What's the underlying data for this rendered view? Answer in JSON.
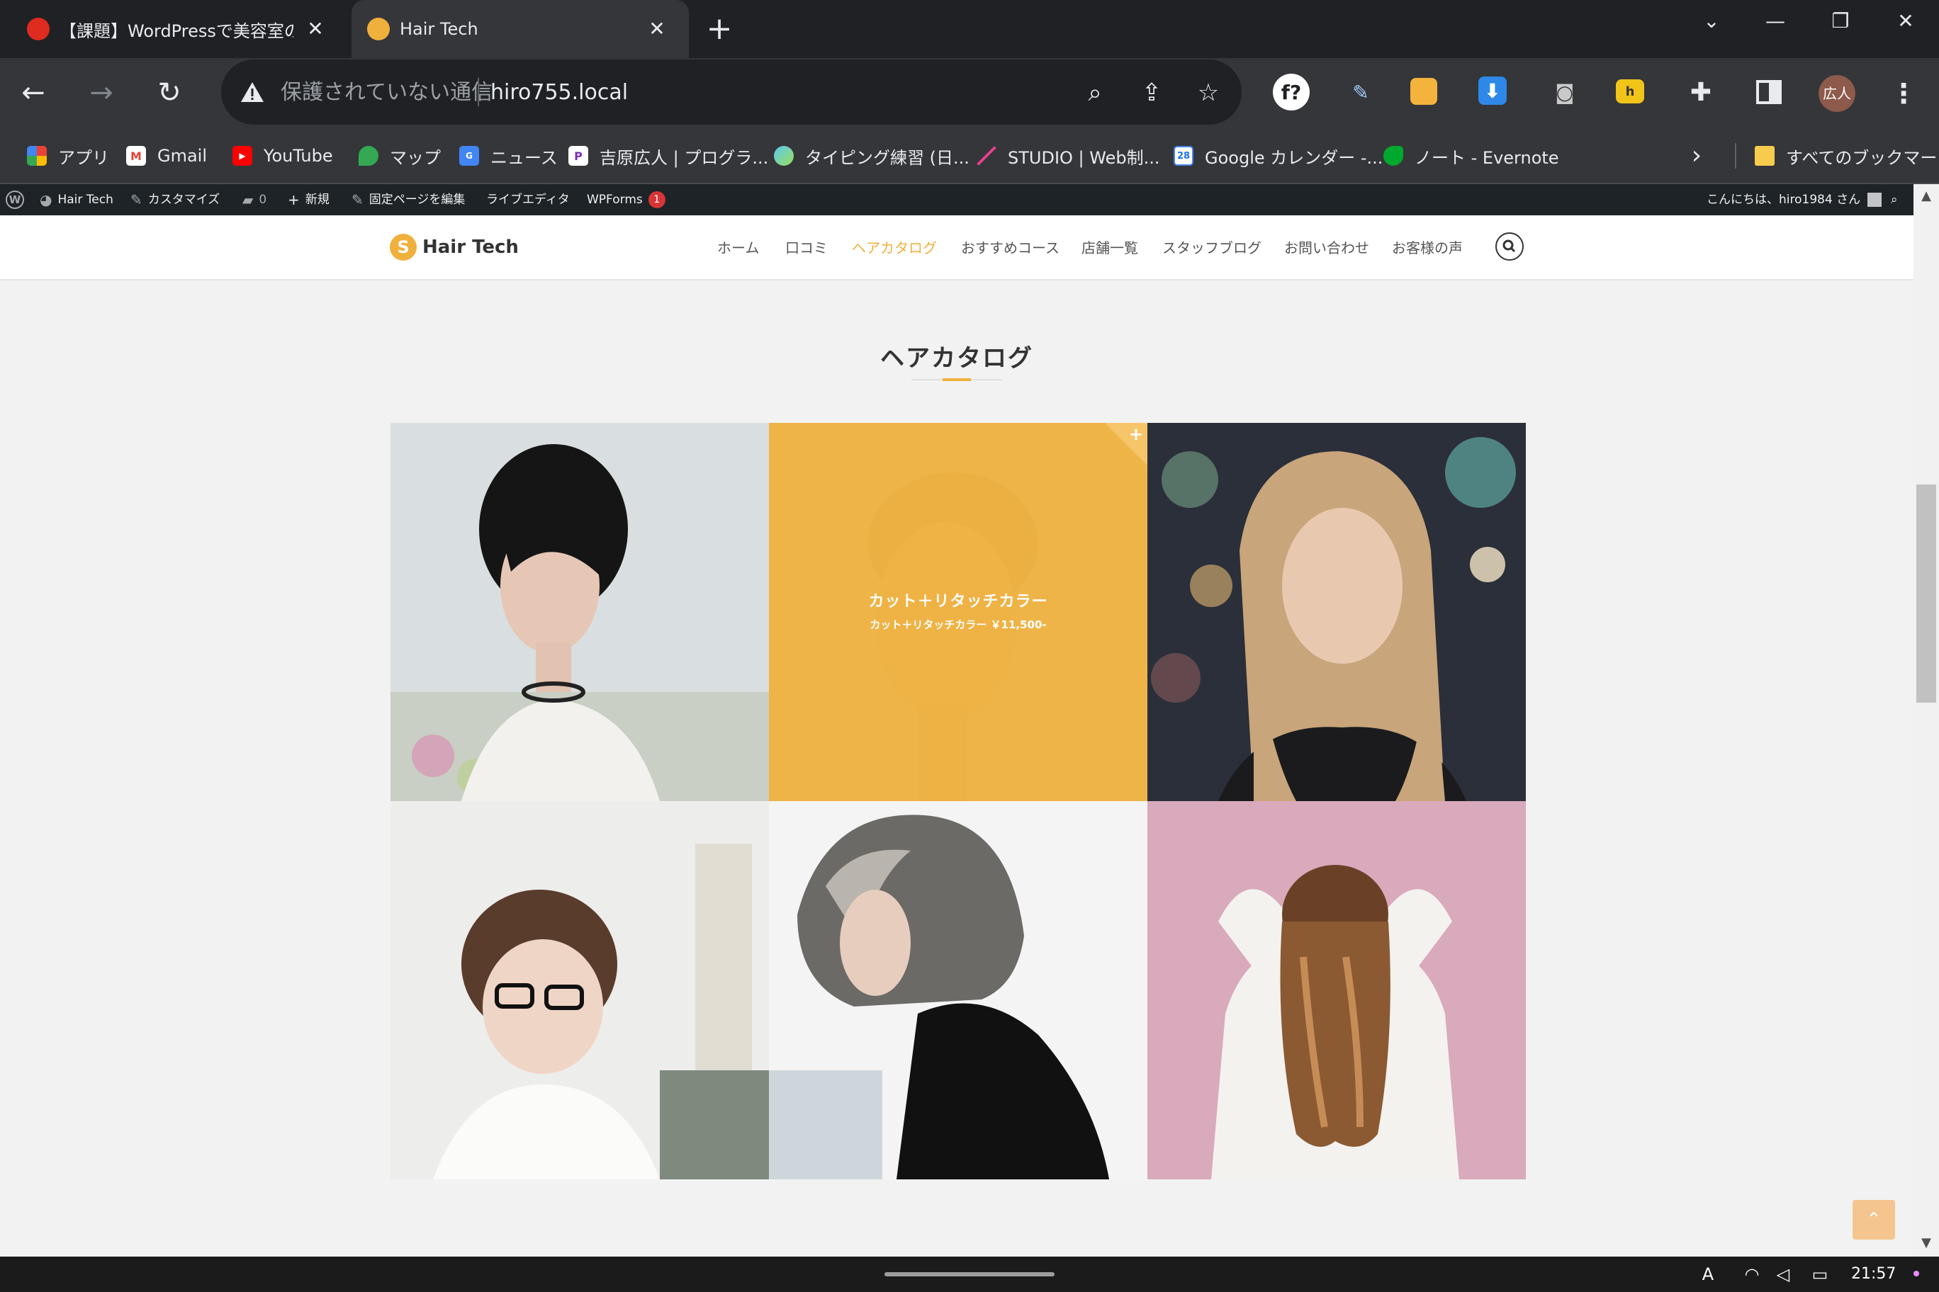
{
  "browser": {
    "tabs": [
      {
        "title": "【課題】WordPressで美容室のサ",
        "active": false,
        "favicon_color": "#e02b20"
      },
      {
        "title": "Hair Tech",
        "active": true,
        "favicon_color": "#f0b03c"
      }
    ],
    "new_tab_icon": "plus-icon",
    "window_controls": [
      "chevron-down-icon",
      "minimize-icon",
      "restore-icon",
      "close-icon"
    ],
    "address": {
      "security_text": "保護されていない通信",
      "url": "hiro755.local"
    },
    "profile_label": "広人",
    "bookmarks": [
      {
        "label": "アプリ",
        "icon": "apps-grid-icon"
      },
      {
        "label": "Gmail",
        "icon": "gmail-icon"
      },
      {
        "label": "YouTube",
        "icon": "youtube-icon"
      },
      {
        "label": "マップ",
        "icon": "maps-pin-icon"
      },
      {
        "label": "ニュース",
        "icon": "news-icon"
      },
      {
        "label": "吉原広人 | プログラ...",
        "icon": "portfolio-icon"
      },
      {
        "label": "タイピング練習 (日...",
        "icon": "typing-icon"
      },
      {
        "label": "STUDIO | Web制...",
        "icon": "studio-icon"
      },
      {
        "label": "Google カレンダー -...",
        "icon": "calendar-icon"
      },
      {
        "label": "ノート - Evernote",
        "icon": "evernote-icon"
      }
    ],
    "all_bookmarks_label": "すべてのブックマーク"
  },
  "adminbar": {
    "site_name": "Hair Tech",
    "customize": "カスタマイズ",
    "comments_count": "0",
    "new_label": "新規",
    "edit_page": "固定ページを編集",
    "live_editor": "ライブエディタ",
    "wpforms": "WPForms",
    "wpforms_badge": "1",
    "greeting": "こんにちは、hiro1984 さん"
  },
  "site": {
    "logo_text": "Hair Tech",
    "logo_letter": "S",
    "accent_color": "#f0b03c",
    "nav": [
      {
        "label": "ホーム",
        "active": false
      },
      {
        "label": "口コミ",
        "active": false
      },
      {
        "label": "ヘアカタログ",
        "active": true
      },
      {
        "label": "おすすめコース",
        "active": false
      },
      {
        "label": "店舗一覧",
        "active": false
      },
      {
        "label": "スタッフブログ",
        "active": false
      },
      {
        "label": "お問い合わせ",
        "active": false
      },
      {
        "label": "お客様の声",
        "active": false
      }
    ]
  },
  "page": {
    "section_title": "ヘアカタログ",
    "catalog_items": [
      {
        "image": "short-black-bob-woman-photo"
      },
      {
        "image": "pixie-cut-woman-photo",
        "overlay_title": "カット＋リタッチカラー",
        "overlay_subtitle": "カット＋リタッチカラー ￥11,500-"
      },
      {
        "image": "long-blonde-woman-photo"
      },
      {
        "image": "woman-glasses-bob-photo"
      },
      {
        "image": "grey-wavy-bob-woman-photo"
      },
      {
        "image": "long-wavy-hair-back-photo"
      }
    ]
  },
  "os": {
    "clock": "21:57"
  }
}
